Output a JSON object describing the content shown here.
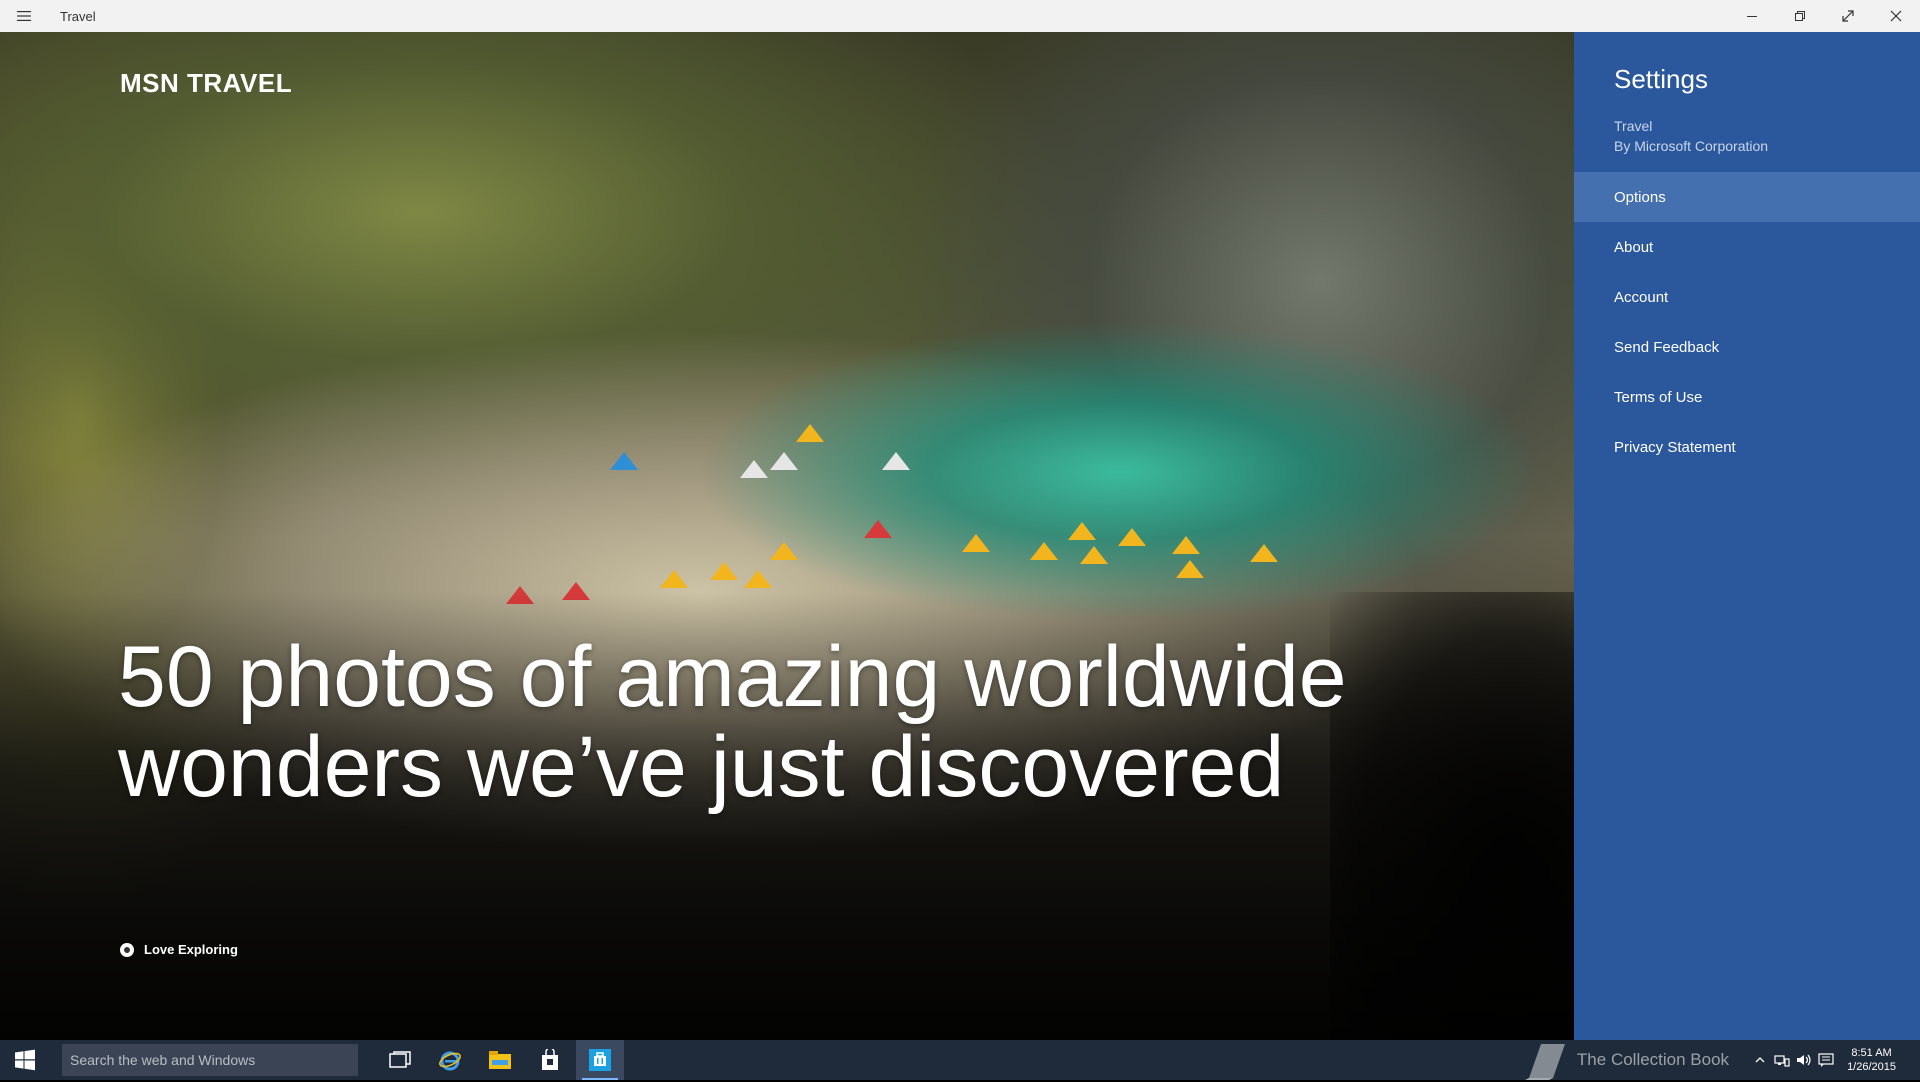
{
  "window": {
    "title": "Travel",
    "menu_icon": "hamburger-icon",
    "minimize_icon": "minimize-icon",
    "restore_icon": "restore-icon",
    "fullscreen_icon": "fullscreen-icon",
    "close_icon": "close-icon"
  },
  "hero": {
    "brand": "MSN TRAVEL",
    "headline": "50 photos of amazing worldwide wonders we’ve just discovered",
    "source": "Love Exploring"
  },
  "settings": {
    "title": "Settings",
    "app_name": "Travel",
    "publisher": "By Microsoft Corporation",
    "items": [
      {
        "label": "Options",
        "selected": true
      },
      {
        "label": "About",
        "selected": false
      },
      {
        "label": "Account",
        "selected": false
      },
      {
        "label": "Send Feedback",
        "selected": false
      },
      {
        "label": "Terms of Use",
        "selected": false
      },
      {
        "label": "Privacy Statement",
        "selected": false
      }
    ],
    "background_color": "#2b589c",
    "selected_color": "#4470b0"
  },
  "taskbar": {
    "search_placeholder": "Search the web and Windows",
    "apps": [
      "task-view-icon",
      "internet-explorer-icon",
      "file-explorer-icon",
      "store-icon",
      "travel-app-icon"
    ],
    "watermark": "The Collection Book",
    "time": "8:51 AM",
    "date": "1/26/2015"
  }
}
